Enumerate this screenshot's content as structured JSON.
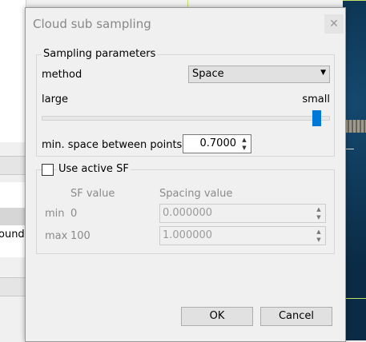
{
  "background": {
    "partial_label": "ound"
  },
  "dialog": {
    "title": "Cloud sub sampling",
    "close_glyph": "✕",
    "sampling_group": {
      "legend": "Sampling parameters",
      "method_label": "method",
      "method_value": "Space",
      "slider_left_label": "large",
      "slider_right_label": "small",
      "slider_level": 1.0,
      "min_space_label": "min. space between points",
      "min_space_value": "0.7000"
    },
    "sf_group": {
      "checkbox_label": "Use active SF",
      "checked": false,
      "col_sf_value": "SF value",
      "col_spacing_value": "Spacing value",
      "rows": [
        {
          "label": "min",
          "sf": "0",
          "spacing": "0.000000"
        },
        {
          "label": "max",
          "sf": "100",
          "spacing": "1.000000"
        }
      ]
    },
    "buttons": {
      "ok": "OK",
      "cancel": "Cancel"
    }
  },
  "colors": {
    "accent": "#0078d7",
    "viewport": "#0a2a45"
  }
}
